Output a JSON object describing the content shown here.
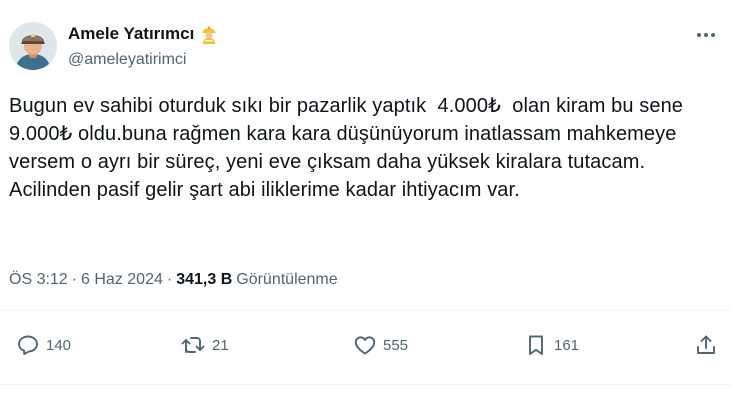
{
  "author": {
    "display_name": "Amele Yatırımcı",
    "handle": "@ameleyatirimci",
    "badge_icon": "construction-worker-emoji"
  },
  "tweet": {
    "text": "Bugun ev sahibi oturduk sıkı bir pazarlik yaptık  4.000₺  olan kiram bu sene  9.000₺ oldu.buna rağmen kara kara düşünüyorum inatlassam mahkemeye versem o ayrı bir süreç, yeni eve çıksam daha yüksek kiralara tutacam. Acilinden pasif gelir şart abi iliklerime kadar ihtiyacım var."
  },
  "meta": {
    "time": "ÖS 3:12",
    "separator": "·",
    "date": "6 Haz 2024",
    "views_count": "341,3 B",
    "views_label": "Görüntülenme"
  },
  "actions": {
    "reply": {
      "icon": "reply-icon",
      "count": "140"
    },
    "retweet": {
      "icon": "retweet-icon",
      "count": "21"
    },
    "like": {
      "icon": "heart-icon",
      "count": "555"
    },
    "bookmark": {
      "icon": "bookmark-icon",
      "count": "161"
    },
    "share": {
      "icon": "share-icon"
    }
  },
  "colors": {
    "text_primary": "#0f1419",
    "text_secondary": "#536471",
    "divider": "#eff3f4"
  }
}
